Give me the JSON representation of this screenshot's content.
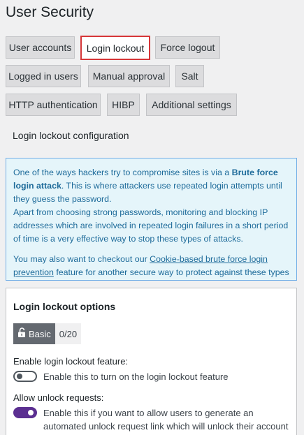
{
  "page": {
    "title": "User Security"
  },
  "tabs": [
    {
      "label": "User accounts"
    },
    {
      "label": "Login lockout"
    },
    {
      "label": "Force logout"
    },
    {
      "label": "Logged in users"
    },
    {
      "label": "Manual approval"
    },
    {
      "label": "Salt"
    },
    {
      "label": "HTTP authentication"
    },
    {
      "label": "HIBP"
    },
    {
      "label": "Additional settings"
    }
  ],
  "active_tab": "Login lockout",
  "section": {
    "title": "Login lockout configuration"
  },
  "info": {
    "p1_before": "One of the ways hackers try to compromise sites is via a ",
    "p1_bold": "Brute force login attack",
    "p1_after": ". This is where attackers use repeated login attempts until they guess the password.",
    "p2": "Apart from choosing strong passwords, monitoring and blocking IP addresses which are involved in repeated login failures in a short period of time is a very effective way to stop these types of attacks.",
    "p3_before": "You may also want to checkout our ",
    "p3_link": "Cookie-based brute force login prevention",
    "p3_after": " feature for another secure way to protect against these types of attacks."
  },
  "options": {
    "title": "Login lockout options",
    "badge_label": "Basic",
    "badge_count": "0/20",
    "enable_label": "Enable login lockout feature:",
    "enable_desc": "Enable this to turn on the login lockout feature",
    "enable_state": false,
    "unlock_label": "Allow unlock requests:",
    "unlock_desc": "Enable this if you want to allow users to generate an automated unlock request link which will unlock their account",
    "unlock_state": true
  },
  "colors": {
    "active_tab_border": "#d63638",
    "info_text": "#1e6b9a",
    "info_bg": "#e5f5fa",
    "toggle_on": "#5b2f91",
    "badge_bg": "#646970"
  }
}
